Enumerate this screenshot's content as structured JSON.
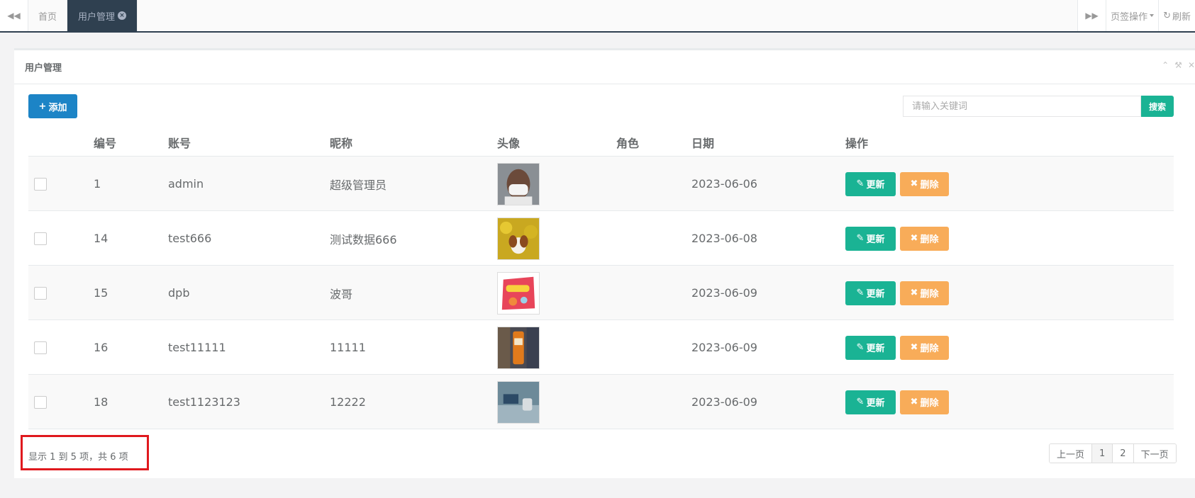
{
  "tabbar": {
    "tabs": [
      {
        "label": "首页"
      },
      {
        "label": "用户管理"
      }
    ],
    "tab_ops_label": "页签操作",
    "refresh_label": "刷新"
  },
  "panel": {
    "title": "用户管理"
  },
  "toolbar": {
    "add_label": "添加",
    "search_placeholder": "请输入关键词",
    "search_label": "搜索"
  },
  "table": {
    "headers": [
      "编号",
      "账号",
      "昵称",
      "头像",
      "角色",
      "日期",
      "操作"
    ],
    "rows": [
      {
        "id": "1",
        "account": "admin",
        "nickname": "超级管理员",
        "role": "",
        "date": "2023-06-06"
      },
      {
        "id": "14",
        "account": "test666",
        "nickname": "测试数据666",
        "role": "",
        "date": "2023-06-08"
      },
      {
        "id": "15",
        "account": "dpb",
        "nickname": "波哥",
        "role": "",
        "date": "2023-06-09"
      },
      {
        "id": "16",
        "account": "test11111",
        "nickname": "11111",
        "role": "",
        "date": "2023-06-09"
      },
      {
        "id": "18",
        "account": "test1123123",
        "nickname": "12222",
        "role": "",
        "date": "2023-06-09"
      }
    ],
    "update_label": "更新",
    "delete_label": "删除"
  },
  "footer": {
    "info": "显示 1 到 5 项，共 6 项",
    "pager": {
      "prev": "上一页",
      "pages": [
        "1",
        "2"
      ],
      "next": "下一页",
      "current": "1"
    }
  },
  "colors": {
    "primary": "#1c84c6",
    "success": "#1ab394",
    "warning": "#f8ac59",
    "highlight": "#e0191e",
    "tab_active": "#2f4050"
  }
}
